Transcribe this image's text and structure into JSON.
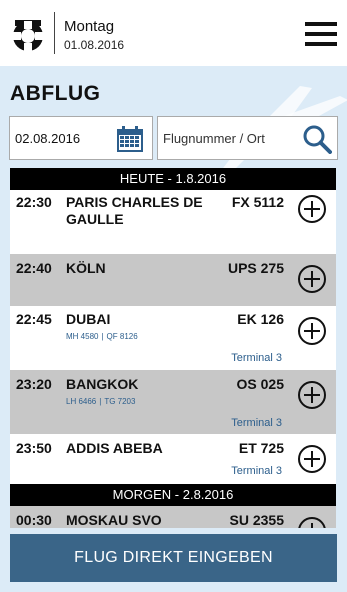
{
  "header": {
    "day": "Montag",
    "date": "01.08.2016"
  },
  "page": {
    "title": "ABFLUG"
  },
  "search": {
    "date_value": "02.08.2016",
    "placeholder": "Flugnummer / Ort"
  },
  "flights": {
    "today_header": "HEUTE - 1.8.2016",
    "tomorrow_header": "MORGEN - 2.8.2016",
    "rows": [
      {
        "time": "22:30",
        "dest_line1": "PARIS CHARLES DE",
        "dest_line2": "GAULLE",
        "flight": "FX 5112"
      },
      {
        "time": "22:40",
        "dest_line1": "KÖLN",
        "flight": "UPS 275"
      },
      {
        "time": "22:45",
        "dest_line1": "DUBAI",
        "flight": "EK 126",
        "codes": [
          "MH 4580",
          "QF 8126"
        ],
        "terminal": "Terminal 3"
      },
      {
        "time": "23:20",
        "dest_line1": "BANGKOK",
        "flight": "OS 025",
        "codes": [
          "LH 6466",
          "TG 7203"
        ],
        "terminal": "Terminal 3"
      },
      {
        "time": "23:50",
        "dest_line1": "ADDIS ABEBA",
        "flight": "ET 725",
        "terminal": "Terminal 3"
      },
      {
        "time": "00:30",
        "dest_line1": "MOSKAU SVO",
        "flight": "SU 2355"
      }
    ]
  },
  "footer": {
    "button_label": "FLUG DIREKT EINGEBEN"
  },
  "icons": {
    "logo": "lifebuoy-logo",
    "menu": "hamburger-menu-icon",
    "calendar": "calendar-icon",
    "search": "search-icon",
    "add": "plus-circle-icon"
  },
  "colors": {
    "panel_bg": "#dcebf7",
    "gray_row": "#c7c7c7",
    "accent_blue": "#2c5e8c",
    "button_bg": "#3a6588"
  }
}
